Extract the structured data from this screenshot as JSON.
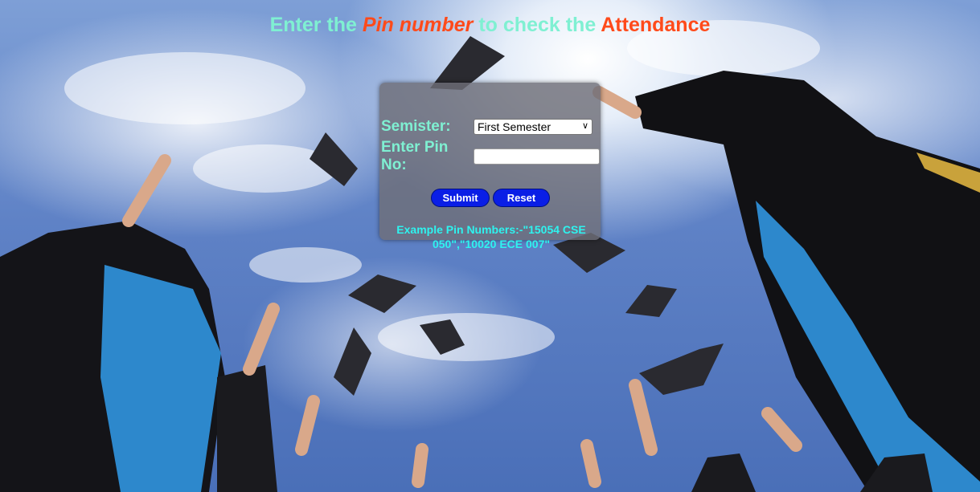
{
  "heading": {
    "part1": "Enter the ",
    "part2": "Pin number",
    "part3": " to check the ",
    "part4": "Attendance"
  },
  "form": {
    "semester_label": "Semister:",
    "semester_selected": "First Semester",
    "pin_label": "Enter Pin No:",
    "pin_value": "",
    "submit_label": "Submit",
    "reset_label": "Reset",
    "example_text": "Example Pin Numbers:-\"15054 CSE 050\",\"10020 ECE 007\""
  },
  "icons": {
    "dropdown": "chevron-down-icon"
  },
  "colors": {
    "heading_teal": "#7ff0d2",
    "heading_orange": "#ff4a1a",
    "button_blue": "#0a1ee6",
    "example_cyan": "#2ef3ef"
  }
}
